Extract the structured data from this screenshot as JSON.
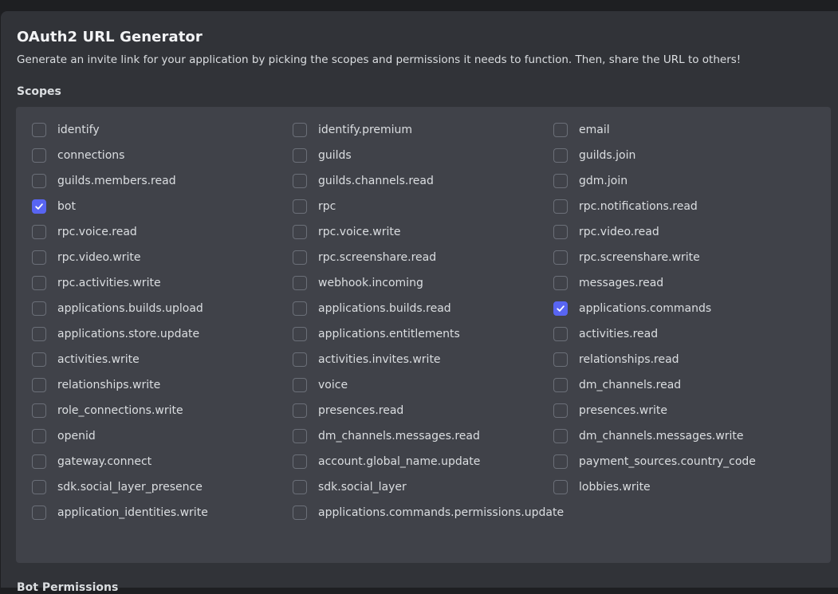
{
  "header": {
    "title": "OAuth2 URL Generator",
    "subtitle": "Generate an invite link for your application by picking the scopes and permissions it needs to function. Then, share the URL to others!"
  },
  "scopes": {
    "label": "Scopes",
    "items": [
      {
        "label": "identify",
        "checked": false
      },
      {
        "label": "identify.premium",
        "checked": false
      },
      {
        "label": "email",
        "checked": false
      },
      {
        "label": "connections",
        "checked": false
      },
      {
        "label": "guilds",
        "checked": false
      },
      {
        "label": "guilds.join",
        "checked": false
      },
      {
        "label": "guilds.members.read",
        "checked": false
      },
      {
        "label": "guilds.channels.read",
        "checked": false
      },
      {
        "label": "gdm.join",
        "checked": false
      },
      {
        "label": "bot",
        "checked": true
      },
      {
        "label": "rpc",
        "checked": false
      },
      {
        "label": "rpc.notifications.read",
        "checked": false
      },
      {
        "label": "rpc.voice.read",
        "checked": false
      },
      {
        "label": "rpc.voice.write",
        "checked": false
      },
      {
        "label": "rpc.video.read",
        "checked": false
      },
      {
        "label": "rpc.video.write",
        "checked": false
      },
      {
        "label": "rpc.screenshare.read",
        "checked": false
      },
      {
        "label": "rpc.screenshare.write",
        "checked": false
      },
      {
        "label": "rpc.activities.write",
        "checked": false
      },
      {
        "label": "webhook.incoming",
        "checked": false
      },
      {
        "label": "messages.read",
        "checked": false
      },
      {
        "label": "applications.builds.upload",
        "checked": false
      },
      {
        "label": "applications.builds.read",
        "checked": false
      },
      {
        "label": "applications.commands",
        "checked": true
      },
      {
        "label": "applications.store.update",
        "checked": false
      },
      {
        "label": "applications.entitlements",
        "checked": false
      },
      {
        "label": "activities.read",
        "checked": false
      },
      {
        "label": "activities.write",
        "checked": false
      },
      {
        "label": "activities.invites.write",
        "checked": false
      },
      {
        "label": "relationships.read",
        "checked": false
      },
      {
        "label": "relationships.write",
        "checked": false
      },
      {
        "label": "voice",
        "checked": false
      },
      {
        "label": "dm_channels.read",
        "checked": false
      },
      {
        "label": "role_connections.write",
        "checked": false
      },
      {
        "label": "presences.read",
        "checked": false
      },
      {
        "label": "presences.write",
        "checked": false
      },
      {
        "label": "openid",
        "checked": false
      },
      {
        "label": "dm_channels.messages.read",
        "checked": false
      },
      {
        "label": "dm_channels.messages.write",
        "checked": false
      },
      {
        "label": "gateway.connect",
        "checked": false
      },
      {
        "label": "account.global_name.update",
        "checked": false
      },
      {
        "label": "payment_sources.country_code",
        "checked": false
      },
      {
        "label": "sdk.social_layer_presence",
        "checked": false
      },
      {
        "label": "sdk.social_layer",
        "checked": false
      },
      {
        "label": "lobbies.write",
        "checked": false
      },
      {
        "label": "application_identities.write",
        "checked": false
      },
      {
        "label": "applications.commands.permissions.update",
        "checked": false
      }
    ]
  },
  "next_section": {
    "label": "Bot Permissions"
  },
  "colors": {
    "accent": "#5865f2",
    "panel_bg": "#313338",
    "scopes_bg": "#404249"
  }
}
